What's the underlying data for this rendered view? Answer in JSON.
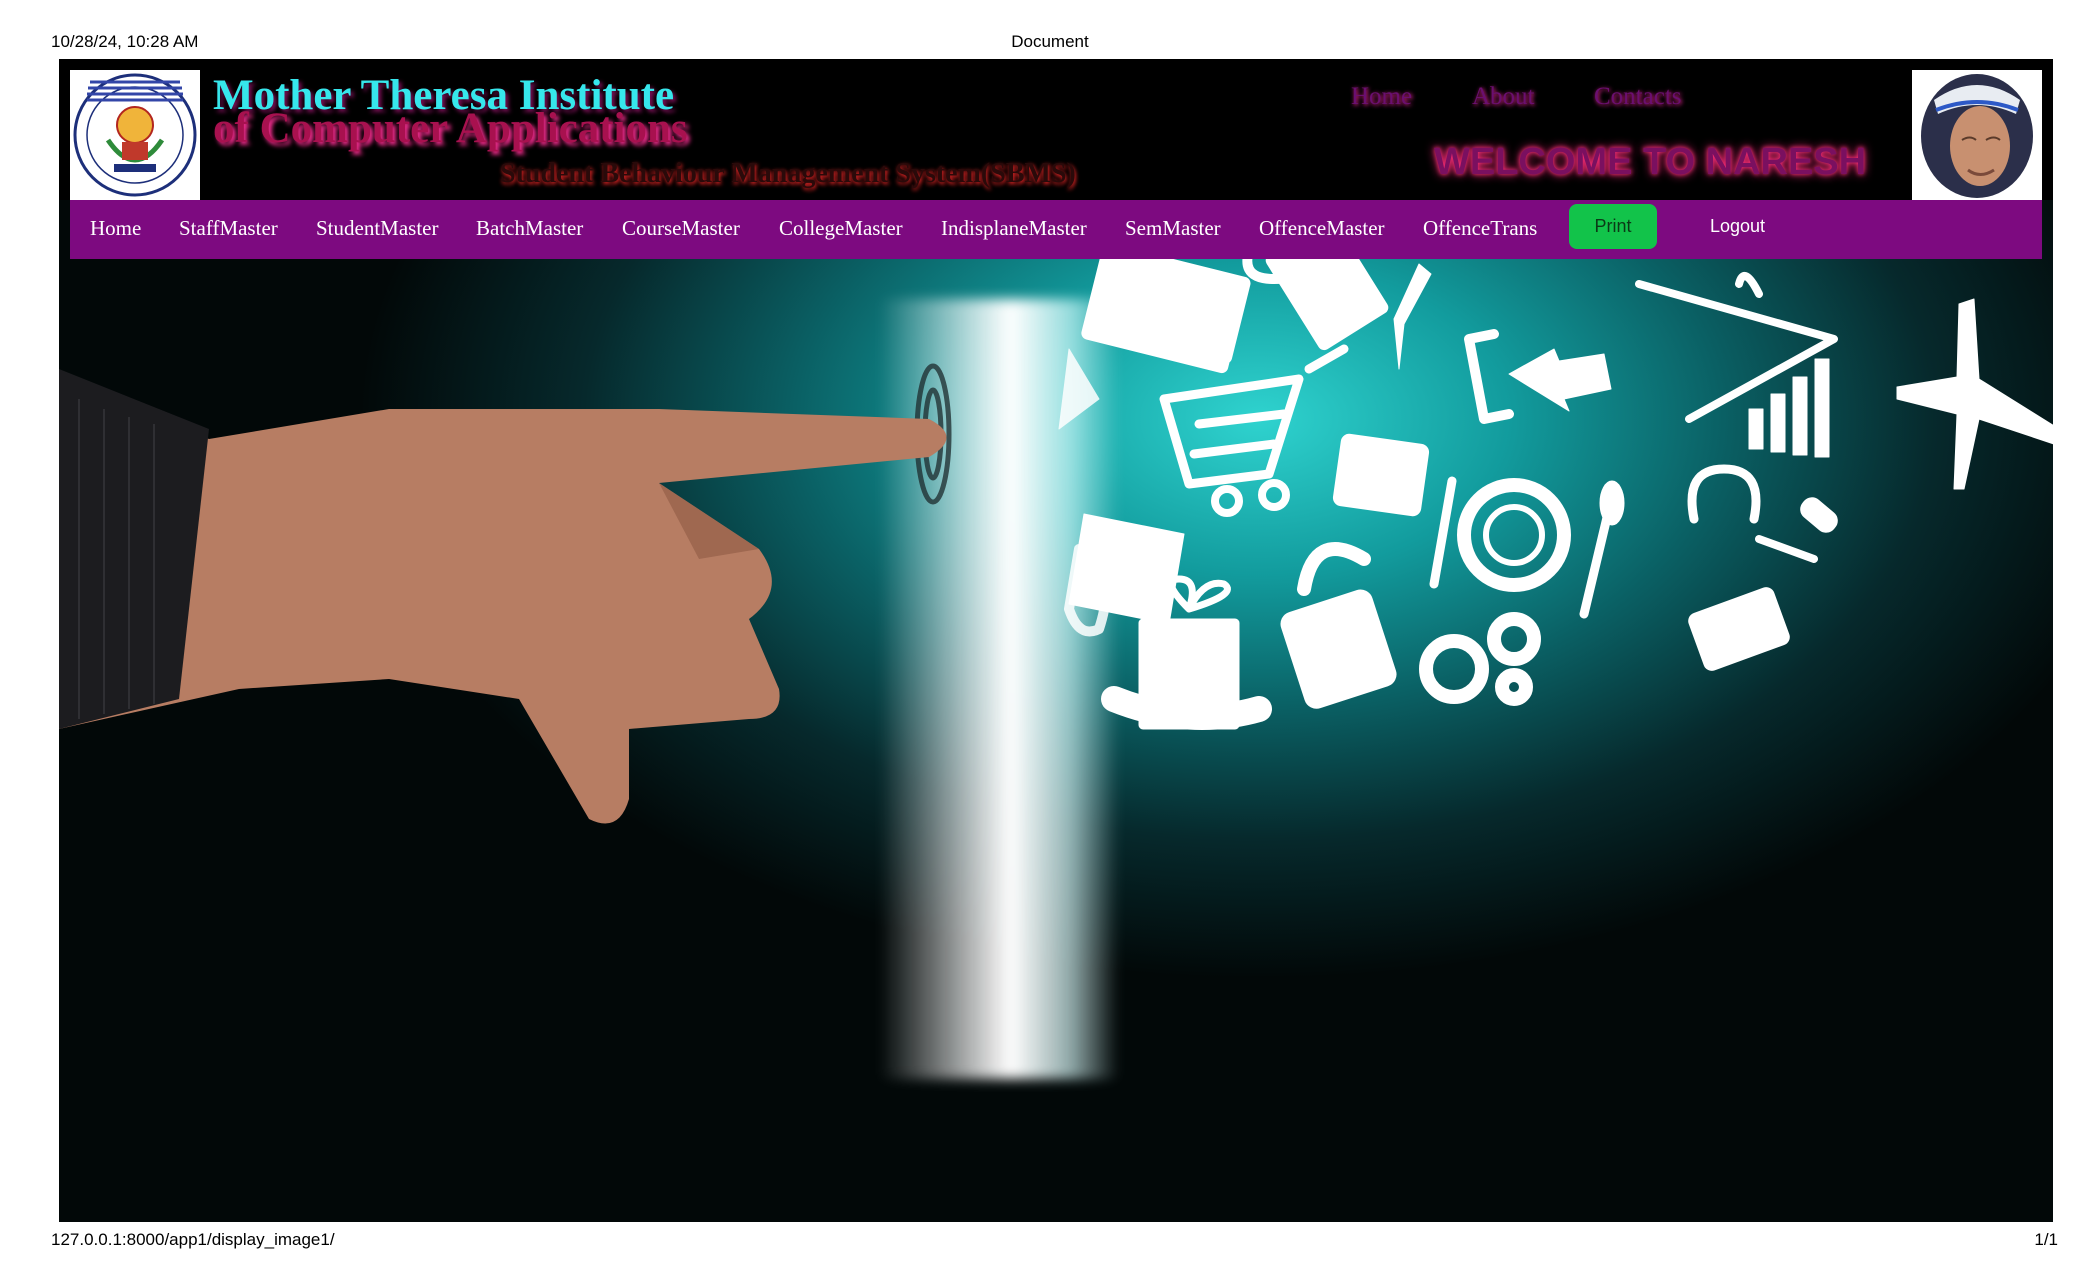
{
  "print_header": {
    "datetime": "10/28/24, 10:28 AM",
    "doc_title": "Document"
  },
  "print_footer": {
    "url": "127.0.0.1:8000/app1/display_image1/",
    "page": "1/1"
  },
  "header": {
    "title_line1": "Mother Theresa Institute",
    "title_line2": "of Computer Applications",
    "subtitle": "Student Behaviour Management System(SBMS)",
    "top_nav": [
      "Home",
      "About",
      "Contacts"
    ],
    "welcome": "WELCOME TO NARESH"
  },
  "menu": {
    "items": [
      "Home",
      "StaffMaster",
      "StudentMaster",
      "BatchMaster",
      "CourseMaster",
      "CollegeMaster",
      "IndisplaneMaster",
      "SemMaster",
      "OffenceMaster",
      "OffenceTrans"
    ],
    "print_label": "Print",
    "logout_label": "Logout"
  },
  "colors": {
    "menu_bar": "#7d0a80",
    "print_button": "#12c34a",
    "title_cyan": "#36e7ec",
    "title_magenta": "#a8114f",
    "welcome": "#7a1060"
  }
}
